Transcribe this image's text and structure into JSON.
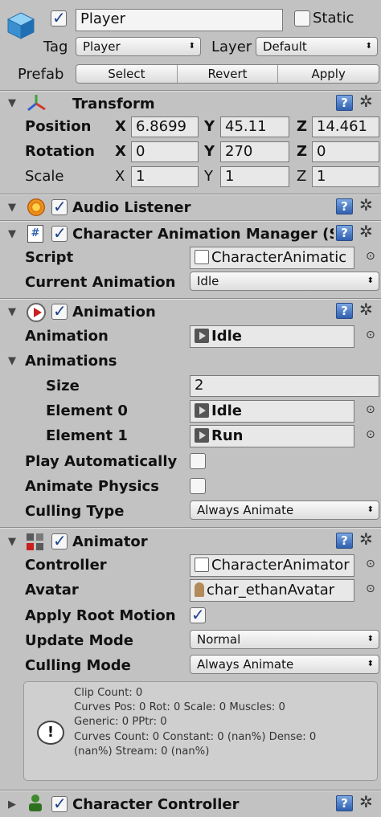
{
  "object": {
    "name": "Player",
    "static_label": "Static",
    "tag_label": "Tag",
    "tag_value": "Player",
    "layer_label": "Layer",
    "layer_value": "Default",
    "prefab_label": "Prefab",
    "select_label": "Select",
    "revert_label": "Revert",
    "apply_label": "Apply"
  },
  "transform": {
    "title": "Transform",
    "position_label": "Position",
    "rotation_label": "Rotation",
    "scale_label": "Scale",
    "axis_x": "X",
    "axis_y": "Y",
    "axis_z": "Z",
    "position": {
      "x": "6.8699",
      "y": "45.11",
      "z": "14.461"
    },
    "rotation": {
      "x": "0",
      "y": "270",
      "z": "0"
    },
    "scale": {
      "x": "1",
      "y": "1",
      "z": "1"
    }
  },
  "audio_listener": {
    "title": "Audio Listener"
  },
  "cam": {
    "title": "Character Animation Manager (Sc",
    "script_label": "Script",
    "script_value": "CharacterAnimatic",
    "current_label": "Current Animation",
    "current_value": "Idle"
  },
  "animation": {
    "title": "Animation",
    "animation_label": "Animation",
    "animation_value": "Idle",
    "animations_label": "Animations",
    "size_label": "Size",
    "size_value": "2",
    "element0_label": "Element 0",
    "element0_value": "Idle",
    "element1_label": "Element 1",
    "element1_value": "Run",
    "play_auto_label": "Play Automatically",
    "animate_physics_label": "Animate Physics",
    "culling_label": "Culling Type",
    "culling_value": "Always Animate"
  },
  "animator": {
    "title": "Animator",
    "controller_label": "Controller",
    "controller_value": "CharacterAnimator",
    "avatar_label": "Avatar",
    "avatar_value": "char_ethanAvatar",
    "root_motion_label": "Apply Root Motion",
    "update_label": "Update Mode",
    "update_value": "Normal",
    "culling_label": "Culling Mode",
    "culling_value": "Always Animate",
    "info_lines": [
      "Clip Count: 0",
      "Curves Pos: 0 Rot: 0 Scale: 0 Muscles: 0",
      "Generic: 0 PPtr: 0",
      "Curves Count: 0 Constant: 0 (nan%) Dense: 0",
      "(nan%) Stream: 0 (nan%)"
    ]
  },
  "character_controller": {
    "title": "Character Controller"
  },
  "icons": {
    "help": "?",
    "gear": "✲",
    "object_picker": "⊙",
    "fold_open": "▼",
    "fold_closed": "▶",
    "arrows": "⬍"
  }
}
